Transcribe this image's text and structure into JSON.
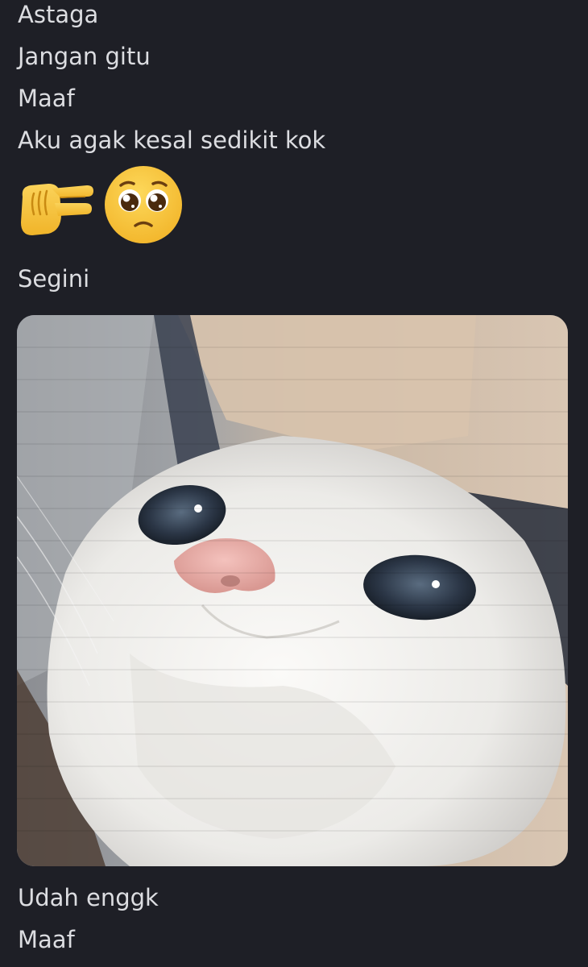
{
  "messages": {
    "m1": "Astaga",
    "m2": "Jangan gitu",
    "m3": "Maaf",
    "m4": "Aku agak kesal sedikit kok",
    "m5": "Segini",
    "m6": "Udah enggk",
    "m7": "Maaf"
  },
  "emojis": [
    "pinching-hand-icon",
    "pleading-face-icon"
  ],
  "attachment": {
    "type": "image",
    "subject": "cat-photo"
  },
  "colors": {
    "background": "#1e1f26",
    "text": "#dcdde1",
    "emoji_yellow": "#f7c94a"
  }
}
